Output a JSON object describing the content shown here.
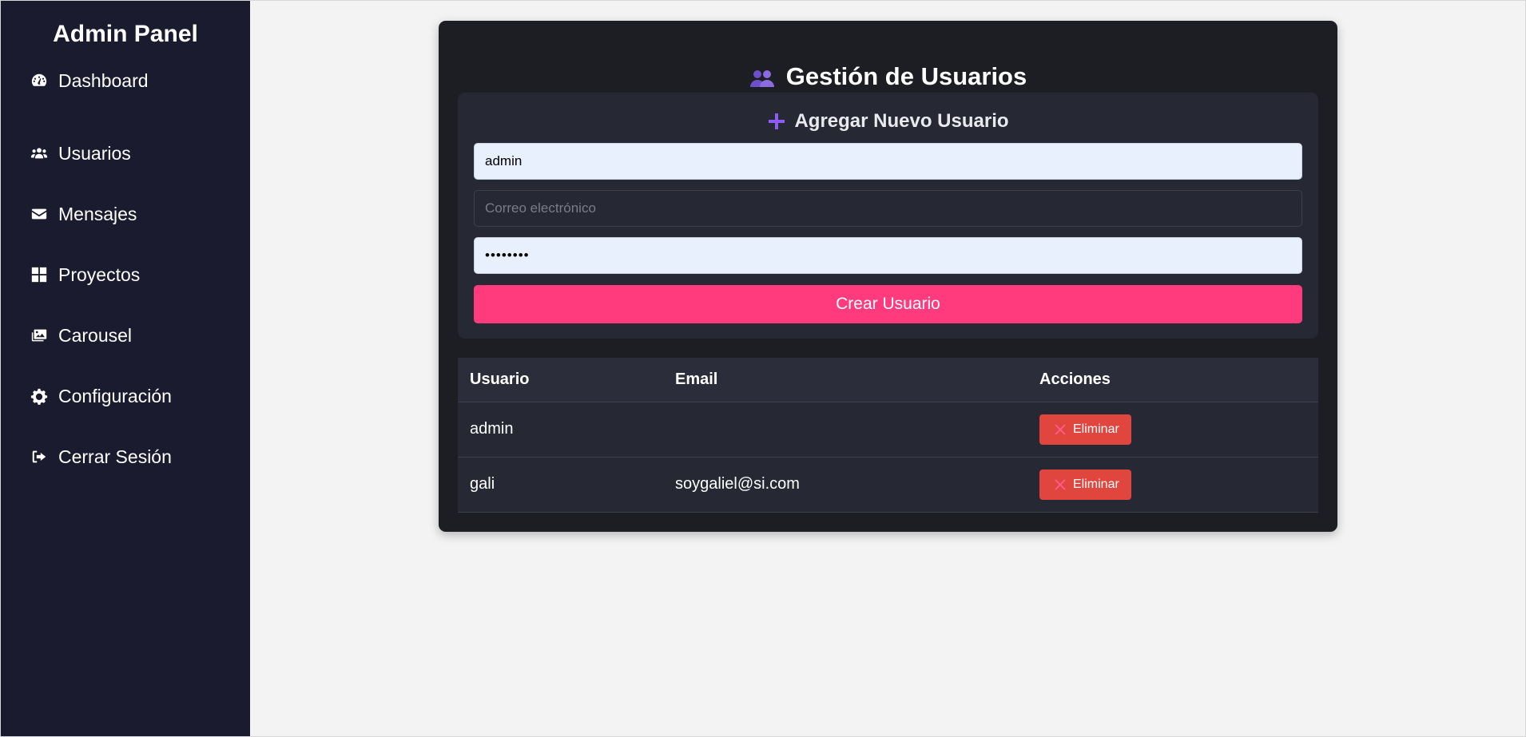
{
  "sidebar": {
    "brand": "Admin Panel",
    "items": [
      {
        "label": "Dashboard",
        "icon": "dashboard-icon"
      },
      {
        "label": "Usuarios",
        "icon": "users-icon"
      },
      {
        "label": "Mensajes",
        "icon": "envelope-icon"
      },
      {
        "label": "Proyectos",
        "icon": "grid-icon"
      },
      {
        "label": "Carousel",
        "icon": "images-icon"
      },
      {
        "label": "Configuración",
        "icon": "gear-icon"
      },
      {
        "label": "Cerrar Sesión",
        "icon": "sign-out-icon"
      }
    ]
  },
  "main": {
    "title": "Gestión de Usuarios",
    "title_icon": "users-icon",
    "form": {
      "title": "Agregar Nuevo Usuario",
      "username_value": "admin",
      "email_placeholder": "Correo electrónico",
      "email_value": "",
      "password_value": "••••••••",
      "submit_label": "Crear Usuario"
    },
    "table": {
      "headers": [
        "Usuario",
        "Email",
        "Acciones"
      ],
      "rows": [
        {
          "usuario": "admin",
          "email": "",
          "action": "Eliminar"
        },
        {
          "usuario": "gali",
          "email": "soygaliel@si.com",
          "action": "Eliminar"
        }
      ]
    }
  },
  "colors": {
    "sidebar_bg": "#1b1b30",
    "card_bg": "#1c1e24",
    "accent_pink": "#ff3b7e",
    "delete_red": "#e0453e",
    "icon_purple": "#8b5cf6"
  }
}
